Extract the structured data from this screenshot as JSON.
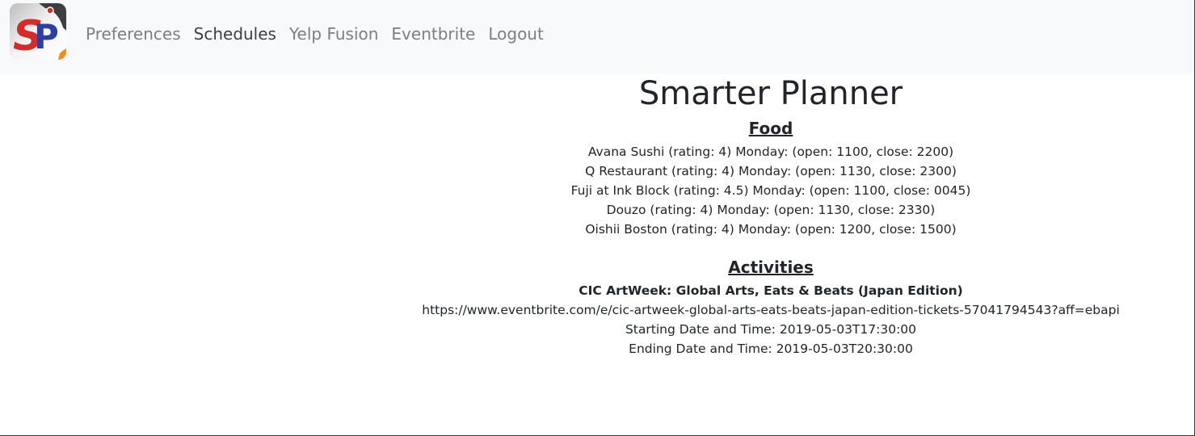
{
  "navbar": {
    "logo_text": "SP",
    "links": [
      {
        "label": "Preferences"
      },
      {
        "label": "Schedules"
      },
      {
        "label": "Yelp Fusion"
      },
      {
        "label": "Eventbrite"
      },
      {
        "label": "Logout"
      }
    ]
  },
  "main": {
    "title": "Smarter Planner",
    "food": {
      "heading": "Food",
      "items": [
        "Avana Sushi (rating: 4) Monday: (open: 1100, close: 2200)",
        "Q Restaurant (rating: 4) Monday: (open: 1130, close: 2300)",
        "Fuji at Ink Block (rating: 4.5) Monday: (open: 1100, close: 0045)",
        "Douzo (rating: 4) Monday: (open: 1130, close: 2330)",
        "Oishii Boston (rating: 4) Monday: (open: 1200, close: 1500)"
      ]
    },
    "activities": {
      "heading": "Activities",
      "event_title": "CIC ArtWeek: Global Arts, Eats & Beats (Japan Edition)",
      "event_url": "https://www.eventbrite.com/e/cic-artweek-global-arts-eats-beats-japan-edition-tickets-57041794543?aff=ebapi",
      "start": "Starting Date and Time: 2019-05-03T17:30:00",
      "end": "Ending Date and Time: 2019-05-03T20:30:00"
    }
  },
  "colors": {
    "navbar_bg": "#f8f9fa",
    "nav_link": "#7a7f85",
    "nav_link_active": "#3b3f44",
    "logo_red": "#d62b2b",
    "logo_blue": "#2f3f9e"
  }
}
